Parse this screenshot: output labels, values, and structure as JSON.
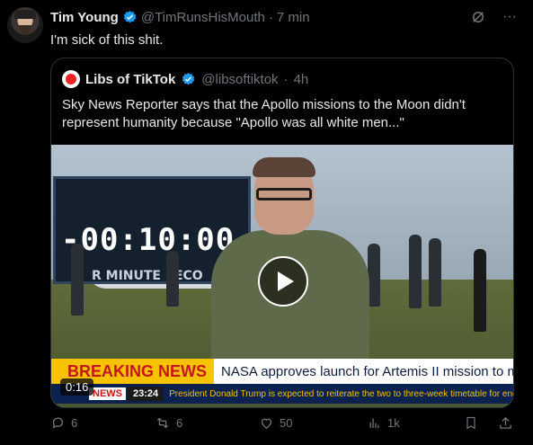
{
  "tweet": {
    "author_name": "Tim Young",
    "author_handle": "@TimRunsHisMouth",
    "separator": "·",
    "time": "7 min",
    "text": "I'm sick of this shit."
  },
  "quote": {
    "author_name": "Libs of TikTok",
    "author_handle": "@libsoftiktok",
    "separator": "·",
    "time": "4h",
    "text": "Sky News Reporter says that the Apollo missions to the Moon didn't represent humanity because \"Apollo was all white men...\"",
    "video": {
      "countdown": "-00:10:00",
      "board_label": "R  MINUTE  SECO",
      "breaking_label": "BREAKING NEWS",
      "breaking_text": "NASA approves launch for Artemis II mission to moon",
      "channel": "NEWS",
      "clock": "23:24",
      "ticker": "President Donald Trump is expected to reiterate the two to three-week timetable for end",
      "duration": "0:16"
    }
  },
  "actions": {
    "replies": "6",
    "reposts": "6",
    "likes": "50",
    "views": "1k"
  },
  "colors": {
    "background": "#000000",
    "text": "#e7e9ea",
    "muted": "#71767b",
    "verified": "#1d9bf0",
    "border": "#2f3336"
  },
  "icons": [
    "verified-badge-icon",
    "grok-icon",
    "more-icon",
    "reply-icon",
    "repost-icon",
    "like-icon",
    "views-icon",
    "share-icon",
    "play-icon"
  ]
}
